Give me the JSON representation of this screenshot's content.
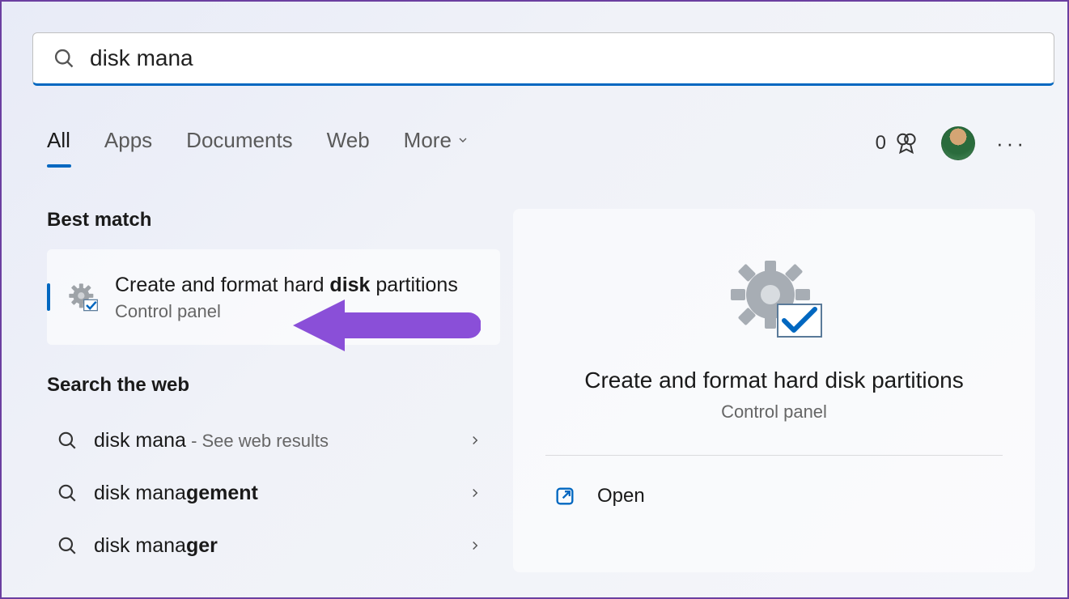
{
  "search": {
    "value": "disk mana"
  },
  "tabs": {
    "all": "All",
    "apps": "Apps",
    "documents": "Documents",
    "web": "Web",
    "more": "More"
  },
  "rewards": {
    "count": "0"
  },
  "sections": {
    "best_match": "Best match",
    "search_web": "Search the web"
  },
  "best_match": {
    "title_pre": "Create and format hard ",
    "title_bold": "disk",
    "title_post": " partitions",
    "subtitle": "Control panel"
  },
  "web_results": [
    {
      "query": "disk mana",
      "bold": "",
      "hint": " - See web results"
    },
    {
      "query": "disk mana",
      "bold": "gement",
      "hint": ""
    },
    {
      "query": "disk mana",
      "bold": "ger",
      "hint": ""
    }
  ],
  "preview": {
    "title": "Create and format hard disk partitions",
    "subtitle": "Control panel",
    "open": "Open"
  }
}
